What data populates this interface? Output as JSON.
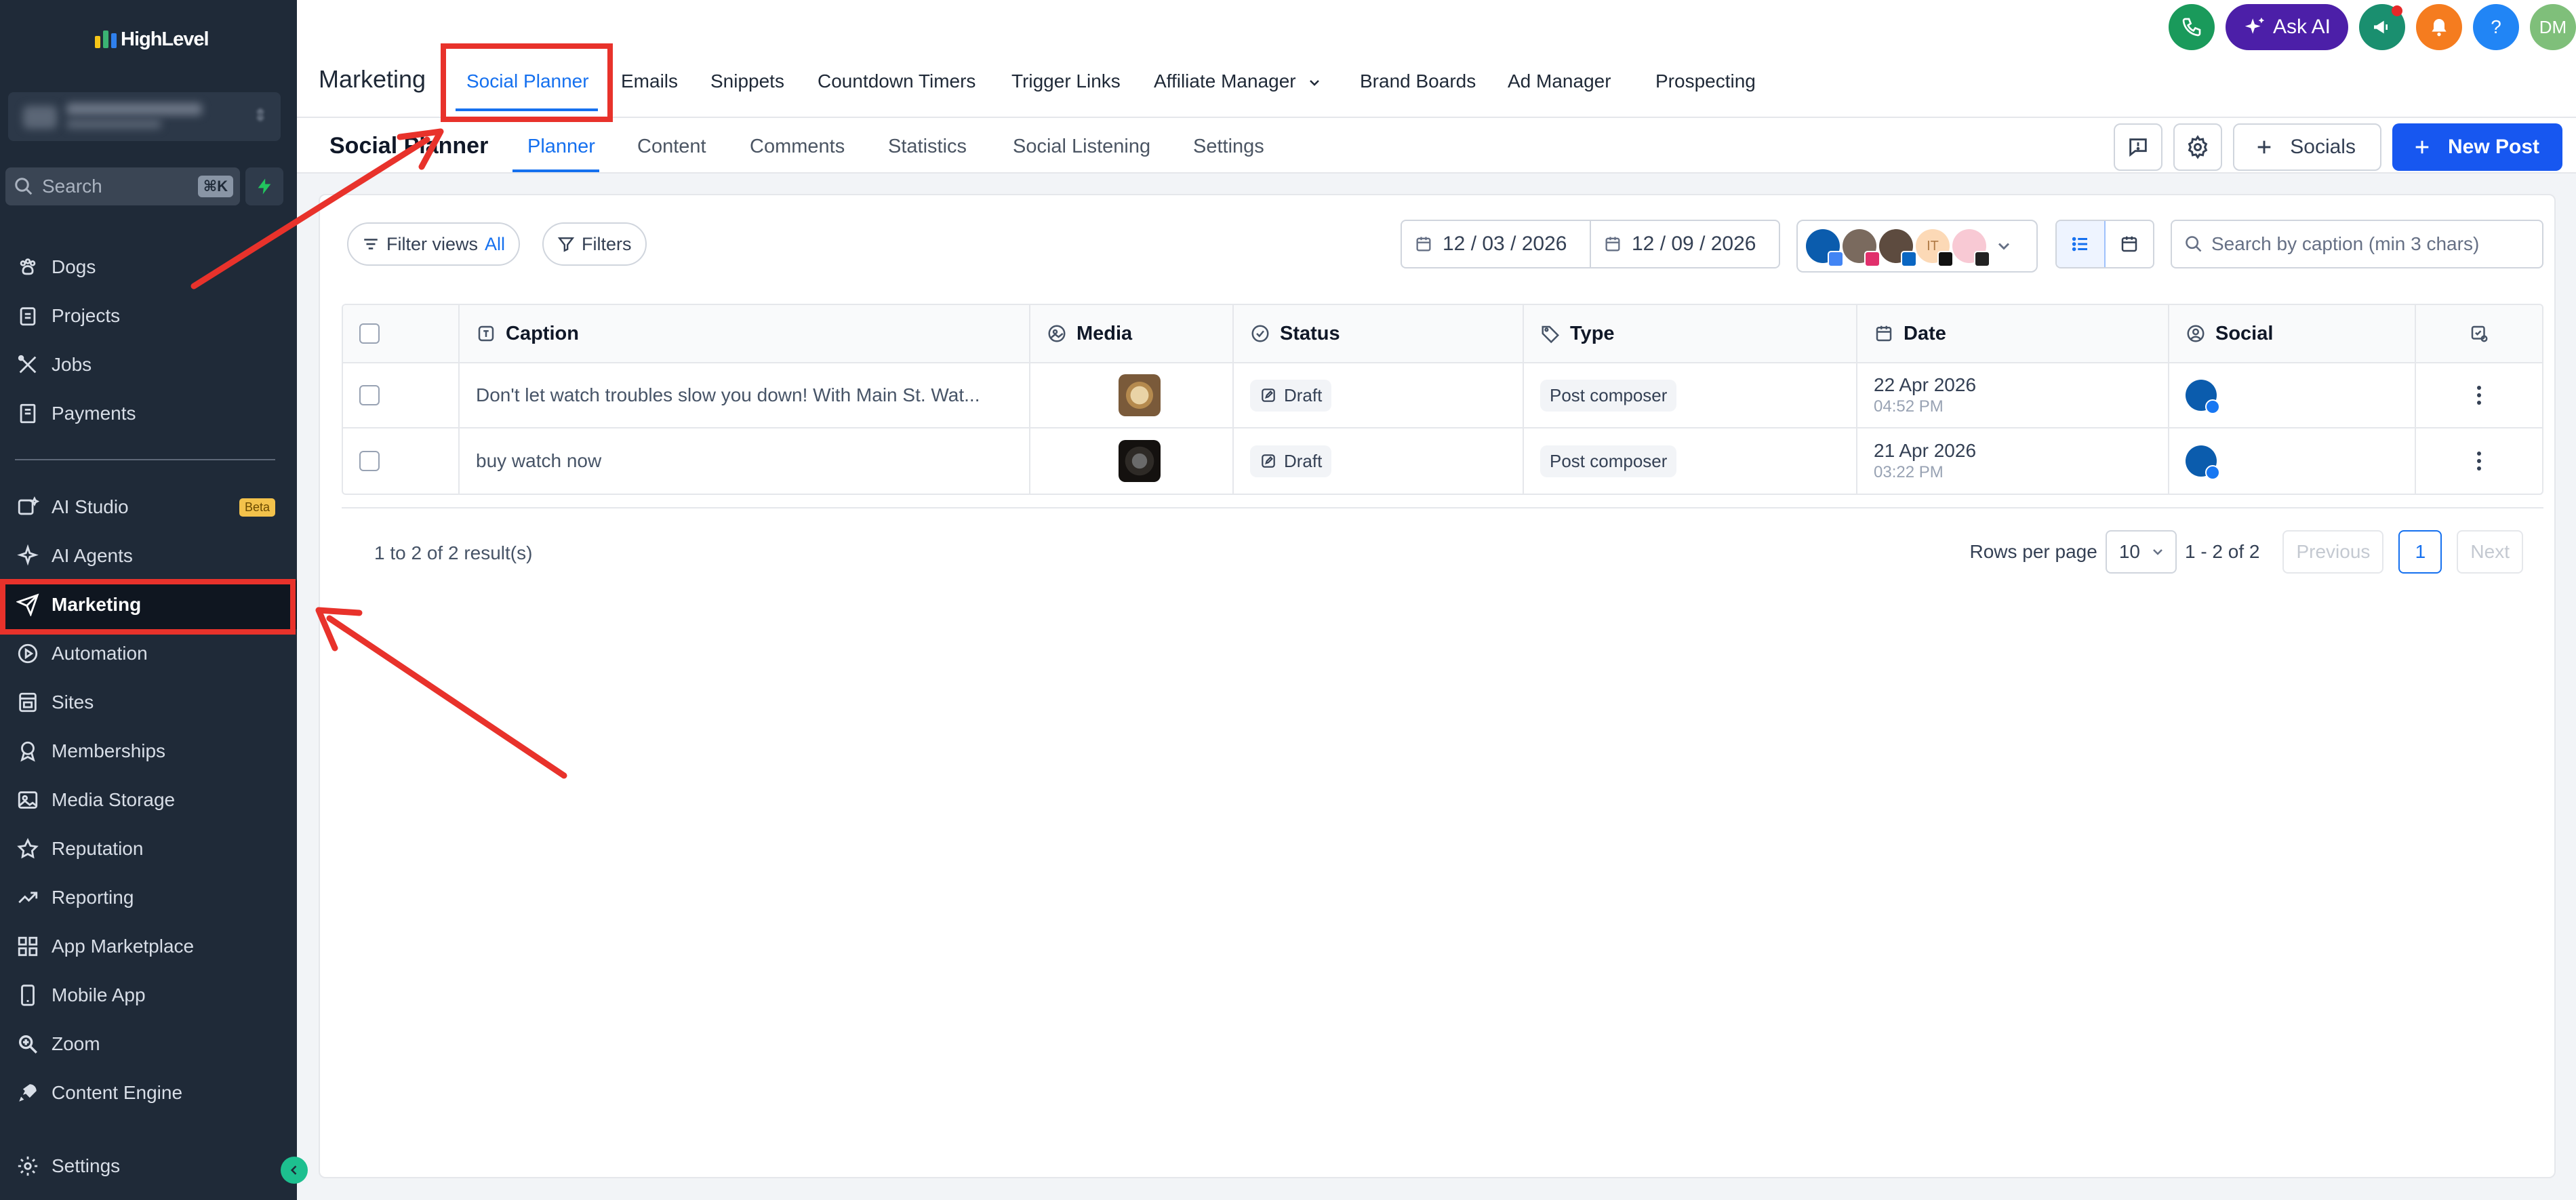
{
  "app": {
    "logo_text": "HighLevel"
  },
  "sidebar": {
    "search_placeholder": "Search",
    "search_shortcut": "⌘K",
    "items_top": [
      {
        "label": "Dogs",
        "icon": "paw-icon"
      },
      {
        "label": "Projects",
        "icon": "clipboard-icon"
      },
      {
        "label": "Jobs",
        "icon": "tools-icon"
      },
      {
        "label": "Payments",
        "icon": "receipt-icon"
      }
    ],
    "items_main": [
      {
        "label": "AI Studio",
        "icon": "ai-studio-icon",
        "badge": "Beta"
      },
      {
        "label": "AI Agents",
        "icon": "sparkle-icon"
      },
      {
        "label": "Marketing",
        "icon": "paper-plane-icon",
        "active": true
      },
      {
        "label": "Automation",
        "icon": "play-circle-icon"
      },
      {
        "label": "Sites",
        "icon": "sites-icon"
      },
      {
        "label": "Memberships",
        "icon": "award-icon"
      },
      {
        "label": "Media Storage",
        "icon": "image-icon"
      },
      {
        "label": "Reputation",
        "icon": "star-icon"
      },
      {
        "label": "Reporting",
        "icon": "trend-icon"
      },
      {
        "label": "App Marketplace",
        "icon": "grid-icon"
      },
      {
        "label": "Mobile App",
        "icon": "phone-icon"
      },
      {
        "label": "Zoom",
        "icon": "zoom-icon"
      },
      {
        "label": "Content Engine",
        "icon": "rocket-icon"
      }
    ],
    "settings_label": "Settings"
  },
  "header": {
    "section_title": "Marketing",
    "tabs": [
      {
        "label": "Social Planner",
        "active": true
      },
      {
        "label": "Emails"
      },
      {
        "label": "Snippets"
      },
      {
        "label": "Countdown Timers"
      },
      {
        "label": "Trigger Links"
      },
      {
        "label": "Affiliate Manager"
      },
      {
        "label": "Brand Boards"
      },
      {
        "label": "Ad Manager"
      },
      {
        "label": "Prospecting"
      }
    ],
    "ask_ai_label": "Ask AI",
    "help_label": "?",
    "user_initials": "DM",
    "colors": {
      "phone": "#1a9a5b",
      "ask_ai": "#4c1fa8",
      "announce": "#1a8f6f",
      "bell": "#f57c1f",
      "help": "#2185f5",
      "avatar": "#7fbf7a"
    }
  },
  "subheader": {
    "title": "Social Planner",
    "tabs": [
      {
        "label": "Planner",
        "active": true
      },
      {
        "label": "Content"
      },
      {
        "label": "Comments"
      },
      {
        "label": "Statistics"
      },
      {
        "label": "Social Listening"
      },
      {
        "label": "Settings"
      }
    ],
    "socials_label": "Socials",
    "new_post_label": "New Post"
  },
  "toolbar": {
    "filter_views_label": "Filter views",
    "filter_views_value": "All",
    "filters_label": "Filters",
    "date_start": "12 / 03 / 2026",
    "date_end": "12 / 09 / 2026",
    "account_initials": "IT",
    "caption_search_placeholder": "Search by caption (min 3 chars)"
  },
  "table": {
    "columns": [
      "Caption",
      "Media",
      "Status",
      "Type",
      "Date",
      "Social"
    ],
    "rows": [
      {
        "caption": "Don't let watch troubles slow you down! With Main St. Wat...",
        "status": "Draft",
        "type": "Post composer",
        "date": "22 Apr 2026",
        "time": "04:52 PM"
      },
      {
        "caption": "buy watch now",
        "status": "Draft",
        "type": "Post composer",
        "date": "21 Apr 2026",
        "time": "03:22 PM"
      }
    ]
  },
  "pagination": {
    "result_text": "1 to 2 of 2 result(s)",
    "rows_per_page_label": "Rows per page",
    "rows_per_page_value": "10",
    "range_text": "1 - 2 of 2",
    "previous_label": "Previous",
    "current_page": "1",
    "next_label": "Next"
  },
  "annotations": {
    "color": "#e8322b"
  }
}
